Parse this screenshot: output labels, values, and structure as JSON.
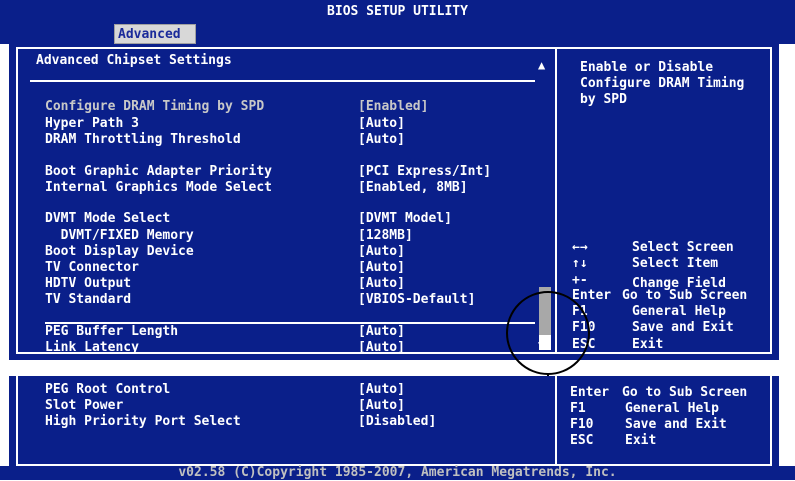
{
  "app": {
    "title": "BIOS SETUP UTILITY",
    "tab": "Advanced"
  },
  "main": {
    "heading": "Advanced Chipset Settings",
    "rows": [
      {
        "label": "Configure DRAM Timing by SPD",
        "value": "[Enabled]"
      },
      {
        "label": "Hyper Path 3",
        "value": "[Auto]"
      },
      {
        "label": "DRAM Throttling Threshold",
        "value": "[Auto]"
      },
      {
        "label": "Boot Graphic Adapter Priority",
        "value": "[PCI Express/Int]"
      },
      {
        "label": "Internal Graphics Mode Select",
        "value": "[Enabled, 8MB]"
      },
      {
        "label": "DVMT Mode Select",
        "value": "[DVMT Model]"
      },
      {
        "label": "  DVMT/FIXED Memory",
        "value": "[128MB]"
      },
      {
        "label": "Boot Display Device",
        "value": "[Auto]"
      },
      {
        "label": "TV Connector",
        "value": "[Auto]"
      },
      {
        "label": "HDTV Output",
        "value": "[Auto]"
      },
      {
        "label": "TV Standard",
        "value": "[VBIOS-Default]"
      },
      {
        "label": "PEG Buffer Length",
        "value": "[Auto]"
      },
      {
        "label": "Link Latency",
        "value": "[Auto]"
      }
    ],
    "help": [
      "Enable or Disable",
      "Configure DRAM Timing",
      "by SPD"
    ],
    "keys": [
      {
        "key": "←→",
        "desc": "Select Screen"
      },
      {
        "key": "↑↓",
        "desc": "Select Item"
      },
      {
        "key": "+-",
        "desc": "Change Field"
      },
      {
        "key": "Enter",
        "desc": "Go to Sub Screen"
      },
      {
        "key": "F1",
        "desc": "General Help"
      },
      {
        "key": "F10",
        "desc": "Save and Exit"
      },
      {
        "key": "ESC",
        "desc": "Exit"
      }
    ],
    "scroll_up": "▲",
    "scroll_down": "▼"
  },
  "lower": {
    "rows": [
      {
        "label": "PEG Root Control",
        "value": "[Auto]"
      },
      {
        "label": "Slot Power",
        "value": "[Auto]"
      },
      {
        "label": "High Priority Port Select",
        "value": "[Disabled]"
      }
    ],
    "keys": [
      {
        "key": "Enter",
        "desc": "Go to Sub Screen"
      },
      {
        "key": "F1",
        "desc": "General Help"
      },
      {
        "key": "F10",
        "desc": "Save and Exit"
      },
      {
        "key": "ESC",
        "desc": "Exit"
      }
    ]
  },
  "footer": "v02.58 (C)Copyright 1985-2007, American Megatrends, Inc.",
  "colors": {
    "background": "#0a1f8a",
    "text": "#ffffff",
    "tab": "#d8d8d8"
  }
}
